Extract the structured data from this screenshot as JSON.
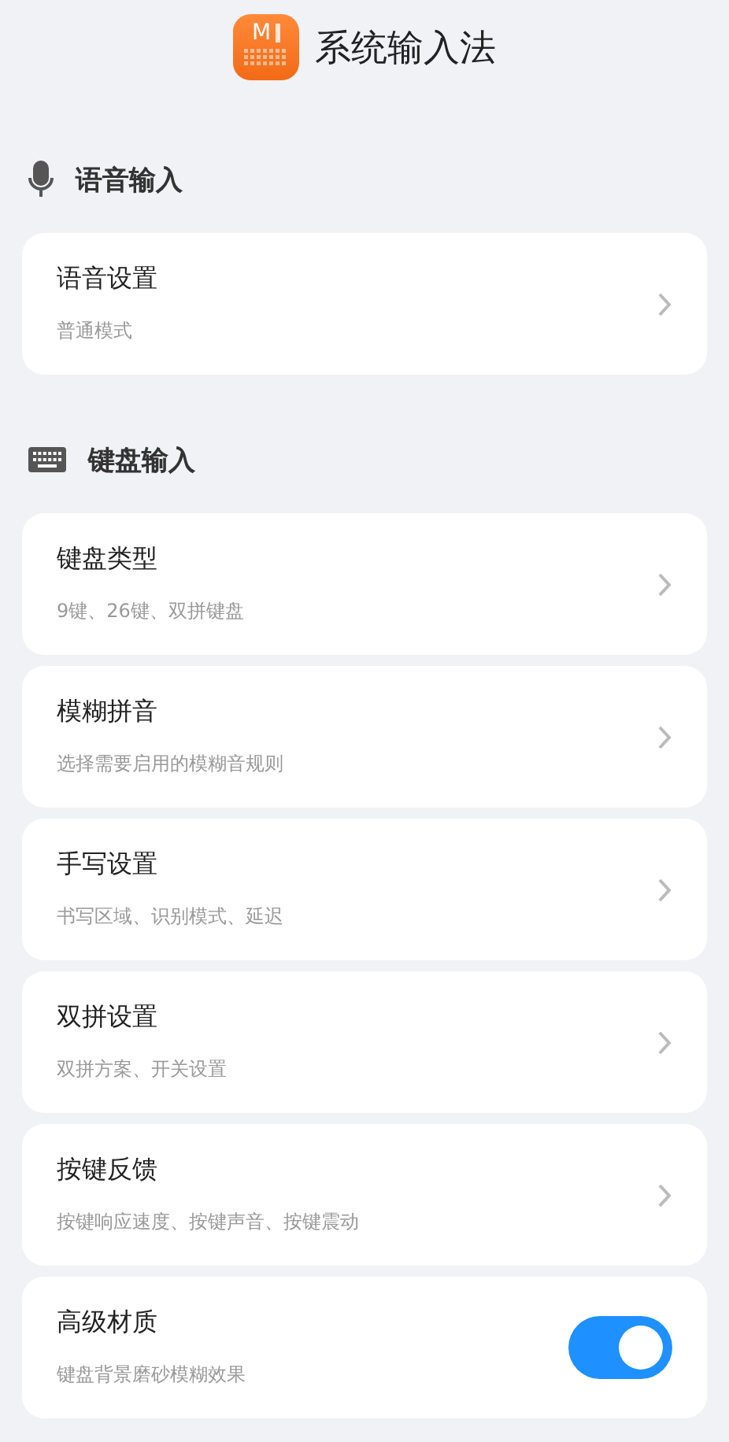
{
  "header": {
    "logo_text": "M",
    "title": "系统输入法"
  },
  "sections": [
    {
      "title": "语音输入",
      "kind": "voice",
      "items": [
        {
          "kind": "link",
          "title": "语音设置",
          "subtitle": "普通模式"
        }
      ]
    },
    {
      "title": "键盘输入",
      "kind": "keyboard",
      "items": [
        {
          "kind": "link",
          "title": "键盘类型",
          "subtitle": "9键、26键、双拼键盘"
        },
        {
          "kind": "link",
          "title": "模糊拼音",
          "subtitle": "选择需要启用的模糊音规则"
        },
        {
          "kind": "link",
          "title": "手写设置",
          "subtitle": "书写区域、识别模式、延迟"
        },
        {
          "kind": "link",
          "title": "双拼设置",
          "subtitle": "双拼方案、开关设置"
        },
        {
          "kind": "link",
          "title": "按键反馈",
          "subtitle": "按键响应速度、按键声音、按键震动"
        },
        {
          "kind": "toggle",
          "title": "高级材质",
          "subtitle": "键盘背景磨砂模糊效果",
          "on": true
        }
      ]
    }
  ]
}
